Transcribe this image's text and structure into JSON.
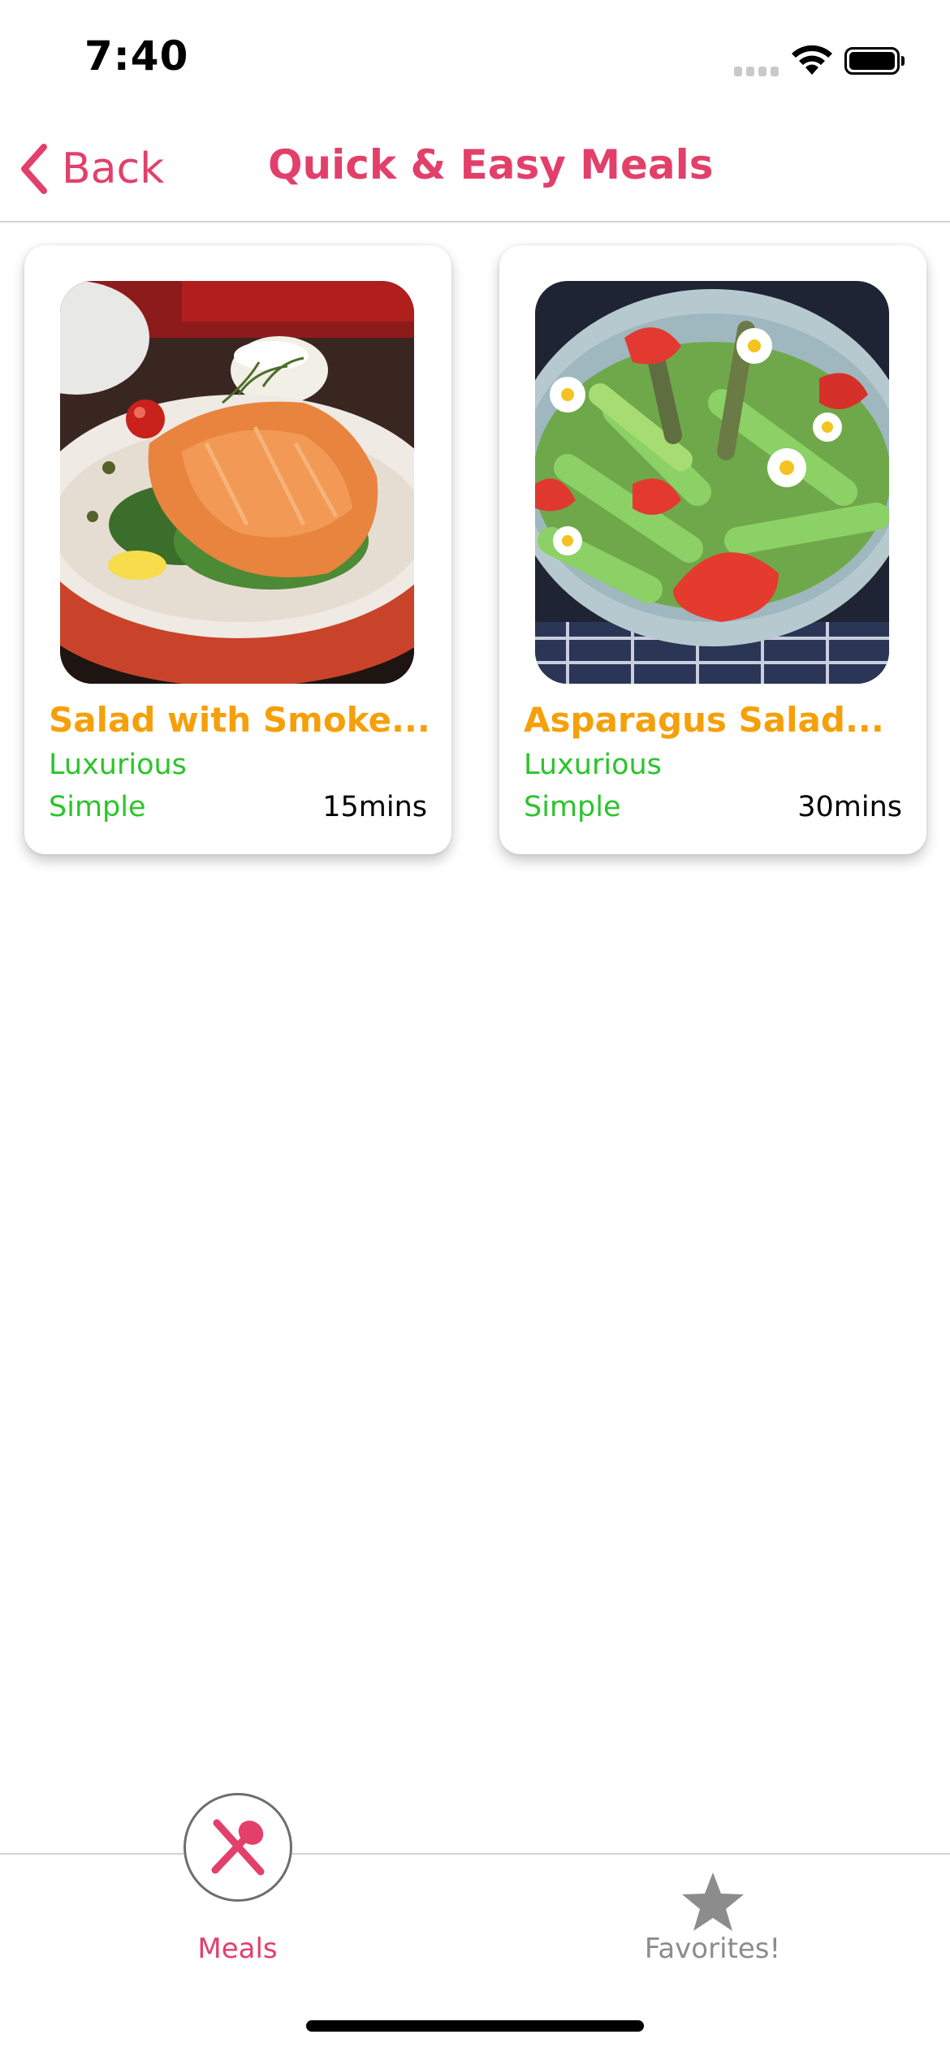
{
  "status_bar": {
    "time": "7:40"
  },
  "nav": {
    "back_label": "Back",
    "title": "Quick & Easy Meals"
  },
  "meals": [
    {
      "title": "Salad with Smoke...",
      "affordability": "Luxurious",
      "complexity": "Simple",
      "duration": "15mins",
      "image": "smoked-salmon-salad-photo"
    },
    {
      "title": "Asparagus Salad...",
      "affordability": "Luxurious",
      "complexity": "Simple",
      "duration": "30mins",
      "image": "asparagus-strawberry-salad-photo"
    }
  ],
  "tabs": [
    {
      "label": "Meals",
      "icon": "utensils-icon",
      "active": true
    },
    {
      "label": "Favorites!",
      "icon": "star-icon",
      "active": false
    }
  ],
  "colors": {
    "accent": "#e2406a",
    "title": "#f5a00a",
    "meta": "#2ac52a",
    "inactive": "#8c8c8c"
  }
}
